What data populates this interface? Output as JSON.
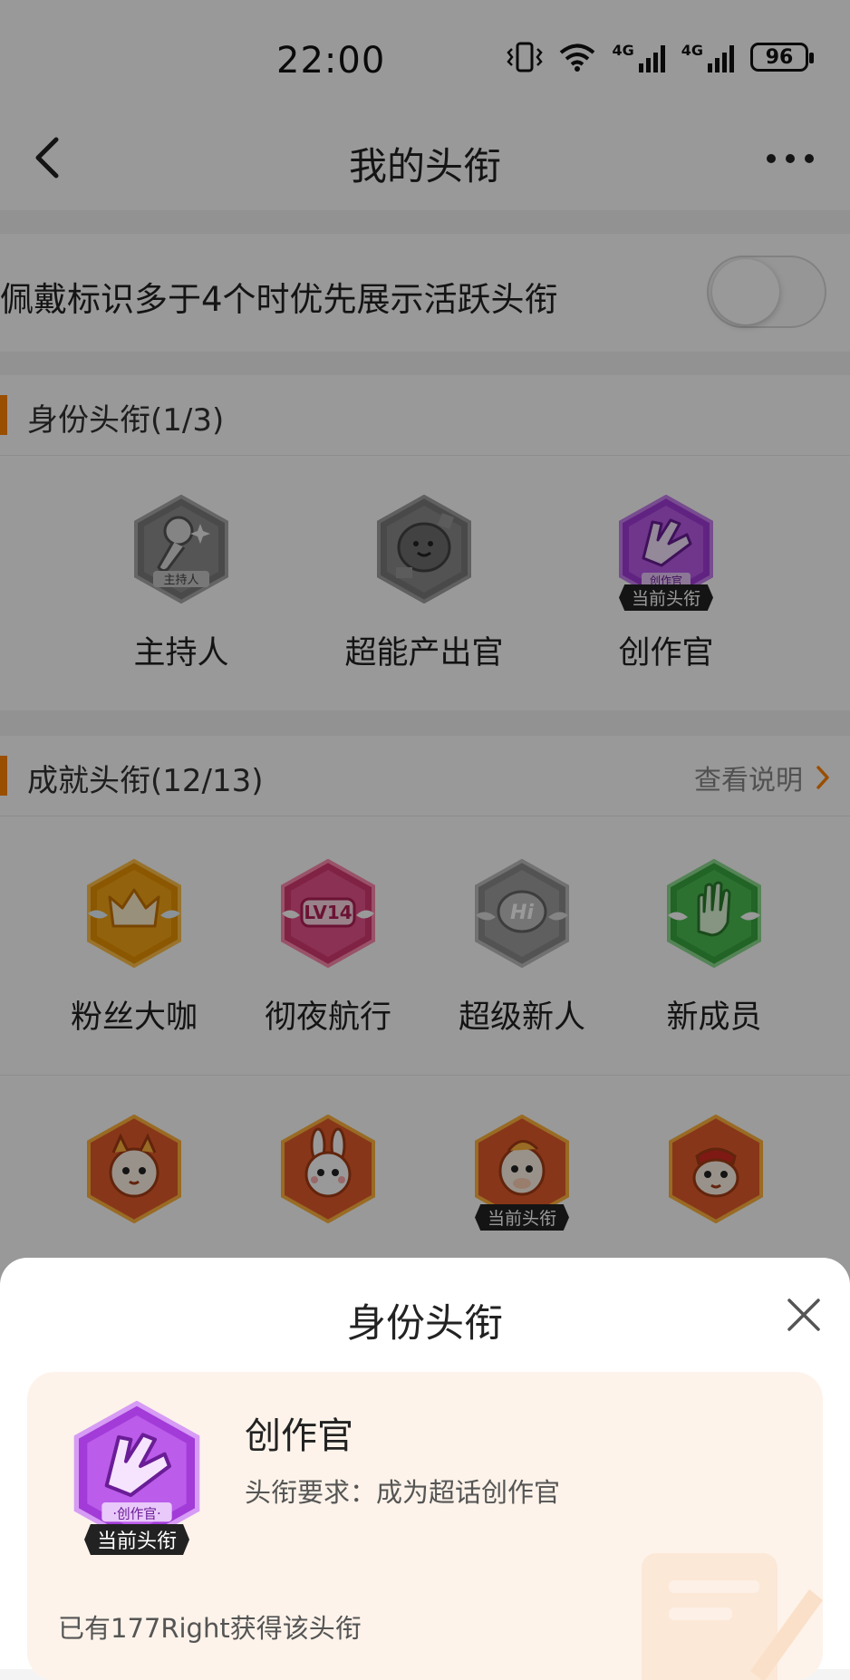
{
  "status_bar": {
    "time": "22:00",
    "battery": "96",
    "net1": "4G",
    "net2": "4G"
  },
  "nav": {
    "title": "我的头衔"
  },
  "toggle": {
    "label": "佩戴标识多于4个时优先展示活跃头衔",
    "on": false
  },
  "identity_section": {
    "title": "身份头衔(1/3)",
    "badges": [
      {
        "name": "主持人",
        "icon": "microphone-badge-icon",
        "caption": "主持人",
        "current": false
      },
      {
        "name": "超能产出官",
        "icon": "rock-badge-icon",
        "current": false
      },
      {
        "name": "创作官",
        "icon": "creator-badge-icon",
        "caption": "创作官",
        "current": true
      }
    ]
  },
  "achievement_section": {
    "title": "成就头衔(12/13)",
    "more_label": "查看说明",
    "badges": [
      {
        "name": "粉丝大咖",
        "icon": "crown-badge-icon",
        "color": "#f5a300"
      },
      {
        "name": "彻夜航行",
        "icon": "lv14-badge-icon",
        "caption": "LV14",
        "color": "#e8447a"
      },
      {
        "name": "超级新人",
        "icon": "hi-badge-icon",
        "caption": "Hi",
        "color": "#9d9d9d"
      },
      {
        "name": "新成员",
        "icon": "hand-badge-icon",
        "color": "#49b94f"
      }
    ],
    "row2_badges": [
      {
        "icon": "dragon-badge-icon",
        "current": false
      },
      {
        "icon": "rabbit-badge-icon",
        "current": false
      },
      {
        "icon": "horse-badge-icon",
        "current": true
      },
      {
        "icon": "snake-badge-icon",
        "current": false
      }
    ]
  },
  "current_tag_label": "当前头衔",
  "sheet": {
    "title": "身份头衔",
    "badge_name": "创作官",
    "requirement": "头衔要求：成为超话创作官",
    "count_text": "已有177Right获得该头衔",
    "badge_caption": "·创作官·"
  }
}
